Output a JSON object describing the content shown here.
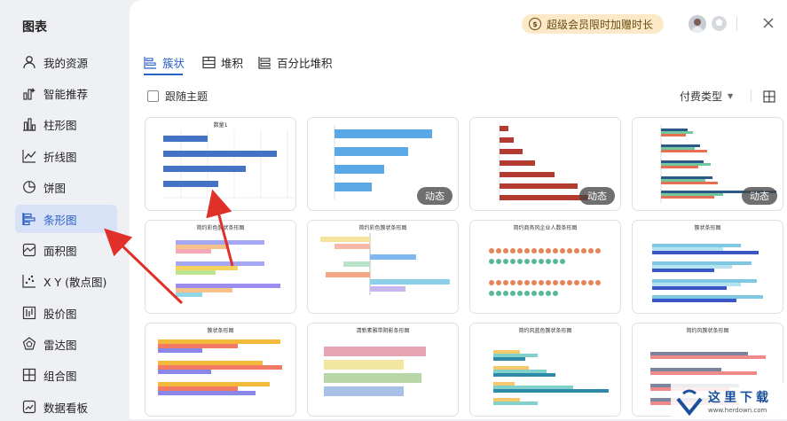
{
  "sidebar": {
    "title": "图表",
    "items": [
      {
        "label": "我的资源"
      },
      {
        "label": "智能推荐"
      },
      {
        "label": "柱形图"
      },
      {
        "label": "折线图"
      },
      {
        "label": "饼图"
      },
      {
        "label": "条形图"
      },
      {
        "label": "面积图"
      },
      {
        "label": "X Y (散点图)"
      },
      {
        "label": "股价图"
      },
      {
        "label": "雷达图"
      },
      {
        "label": "组合图"
      },
      {
        "label": "数据看板"
      }
    ]
  },
  "header": {
    "promo": "超级会员限时加赠时长",
    "promo_icon": "$"
  },
  "tabs": [
    {
      "label": "簇状"
    },
    {
      "label": "堆积"
    },
    {
      "label": "百分比堆积"
    }
  ],
  "toolbar": {
    "follow_theme": "跟随主题",
    "pay_type": "付费类型"
  },
  "cards": [
    {
      "title": "数量1",
      "badge": ""
    },
    {
      "title": "",
      "badge": "动态"
    },
    {
      "title": "",
      "badge": "动态"
    },
    {
      "title": "",
      "badge": "动态"
    },
    {
      "title": "简约彩色簇状条形图",
      "badge": ""
    },
    {
      "title": "简约彩色簇状条形图",
      "badge": ""
    },
    {
      "title": "简约商务风企业人数条形图",
      "badge": ""
    },
    {
      "title": "簇状条形图",
      "badge": ""
    },
    {
      "title": "簇状条形图",
      "badge": ""
    },
    {
      "title": "清新素雅带阴影条形图",
      "badge": ""
    },
    {
      "title": "简约风蓝色簇状条形图",
      "badge": ""
    },
    {
      "title": "简约风簇状条形图",
      "badge": ""
    }
  ],
  "watermark": {
    "title": "这里下载",
    "url": "www.herdown.com"
  },
  "colors": {
    "accent": "#2b5fc9",
    "arrow": "#e0302a"
  }
}
